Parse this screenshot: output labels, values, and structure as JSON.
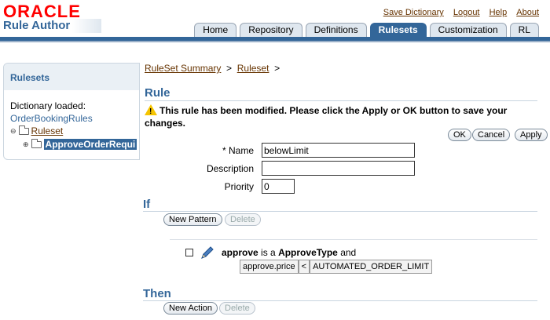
{
  "header": {
    "logo": "ORACLE",
    "app_title": "Rule Author",
    "global_links": [
      "Save Dictionary",
      "Logout",
      "Help",
      "About"
    ],
    "tabs": [
      {
        "label": "Home",
        "active": false
      },
      {
        "label": "Repository",
        "active": false
      },
      {
        "label": "Definitions",
        "active": false
      },
      {
        "label": "Rulesets",
        "active": true
      },
      {
        "label": "Customization",
        "active": false
      },
      {
        "label": "RL",
        "active": false
      }
    ]
  },
  "sidebar": {
    "title": "Rulesets",
    "dictionary_label": "Dictionary loaded:",
    "dictionary_name": "OrderBookingRules",
    "ruleset_node": "Ruleset",
    "rule_node": "ApproveOrderRequi"
  },
  "breadcrumb": {
    "items": [
      "RuleSet Summary",
      "Ruleset"
    ],
    "separator": ">"
  },
  "rule": {
    "section_title": "Rule",
    "warning": "This rule has been modified. Please click the Apply or OK button to save your changes.",
    "buttons": {
      "ok": "OK",
      "cancel": "Cancel",
      "apply": "Apply"
    },
    "name_label": "* Name",
    "name_value": "belowLimit",
    "description_label": "Description",
    "description_value": "",
    "priority_label": "Priority",
    "priority_value": "0"
  },
  "if_section": {
    "title": "If",
    "new_pattern": "New Pattern",
    "delete": "Delete",
    "pattern_var": "approve",
    "pattern_is_a": "is a",
    "pattern_type": "ApproveType",
    "pattern_and": "and",
    "condition_left": "approve.price",
    "condition_op": "<",
    "condition_right": "AUTOMATED_ORDER_LIMIT"
  },
  "then_section": {
    "title": "Then",
    "new_action": "New Action",
    "delete": "Delete"
  },
  "colors": {
    "brand_red": "#ff0000",
    "accent_blue": "#336699",
    "link_brown": "#663300"
  }
}
